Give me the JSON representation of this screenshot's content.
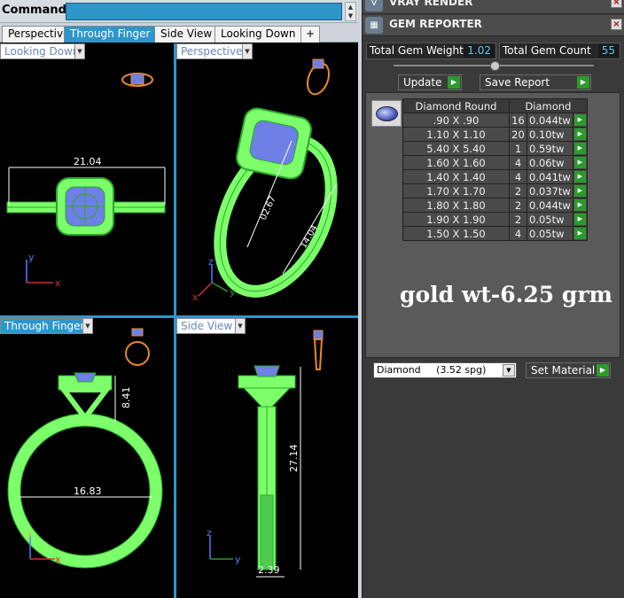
{
  "command_bar": {
    "label": "Command:",
    "value": ""
  },
  "view_tabs": [
    "Perspective",
    "Through Finger",
    "Side View",
    "Looking Down",
    "+"
  ],
  "viewports": {
    "top_left": {
      "title": "Looking Down",
      "dimension": "21.04",
      "axes": [
        "y",
        "x"
      ]
    },
    "top_right": {
      "title": "Perspective",
      "dimensions": [
        "02.67",
        "14.04"
      ],
      "axes": [
        "z",
        "x",
        "y"
      ]
    },
    "bottom_left": {
      "title": "Through Finger",
      "dimensions": [
        "8.41",
        "16.83"
      ],
      "axes": [
        "y",
        "x"
      ]
    },
    "bottom_right": {
      "title": "Side View",
      "dimensions": [
        "27.14",
        "2.39"
      ],
      "axes": [
        "z",
        "y"
      ]
    }
  },
  "right_panel": {
    "vray_header": {
      "title": "VRAY RENDER",
      "icon": "vray-logo-icon"
    },
    "gem_header": {
      "title": "GEM REPORTER",
      "icon": "gem-reporter-icon"
    },
    "total_weight": {
      "label": "Total Gem Weight",
      "value": "1.02"
    },
    "total_count": {
      "label": "Total Gem Count",
      "value": "55"
    },
    "update_button": "Update",
    "save_report": "Save Report",
    "table": {
      "header": [
        "Diamond Round",
        "Diamond"
      ],
      "rows": [
        [
          ".90 X .90",
          "16",
          "0.044tw"
        ],
        [
          "1.10 X 1.10",
          "20",
          "0.10tw"
        ],
        [
          "5.40 X 5.40",
          "1",
          "0.59tw"
        ],
        [
          "1.60 X 1.60",
          "4",
          "0.06tw"
        ],
        [
          "1.40 X 1.40",
          "4",
          "0.041tw"
        ],
        [
          "1.70 X 1.70",
          "2",
          "0.037tw"
        ],
        [
          "1.80 X 1.80",
          "2",
          "0.044tw"
        ],
        [
          "1.90 X 1.90",
          "2",
          "0.05tw"
        ],
        [
          "1.50 X 1.50",
          "4",
          "0.05tw"
        ]
      ]
    },
    "note": "gold wt-6.25 grm",
    "material_select": "Diamond     (3.52 spg)",
    "set_material": "Set Material"
  },
  "colors": {
    "accent_blue": "#2f96c9",
    "mesh_green": "#7cff6a",
    "stone_blue": "#6e7fe6",
    "ring_orange": "#e88a2a",
    "value_cyan": "#5ec8ff"
  }
}
